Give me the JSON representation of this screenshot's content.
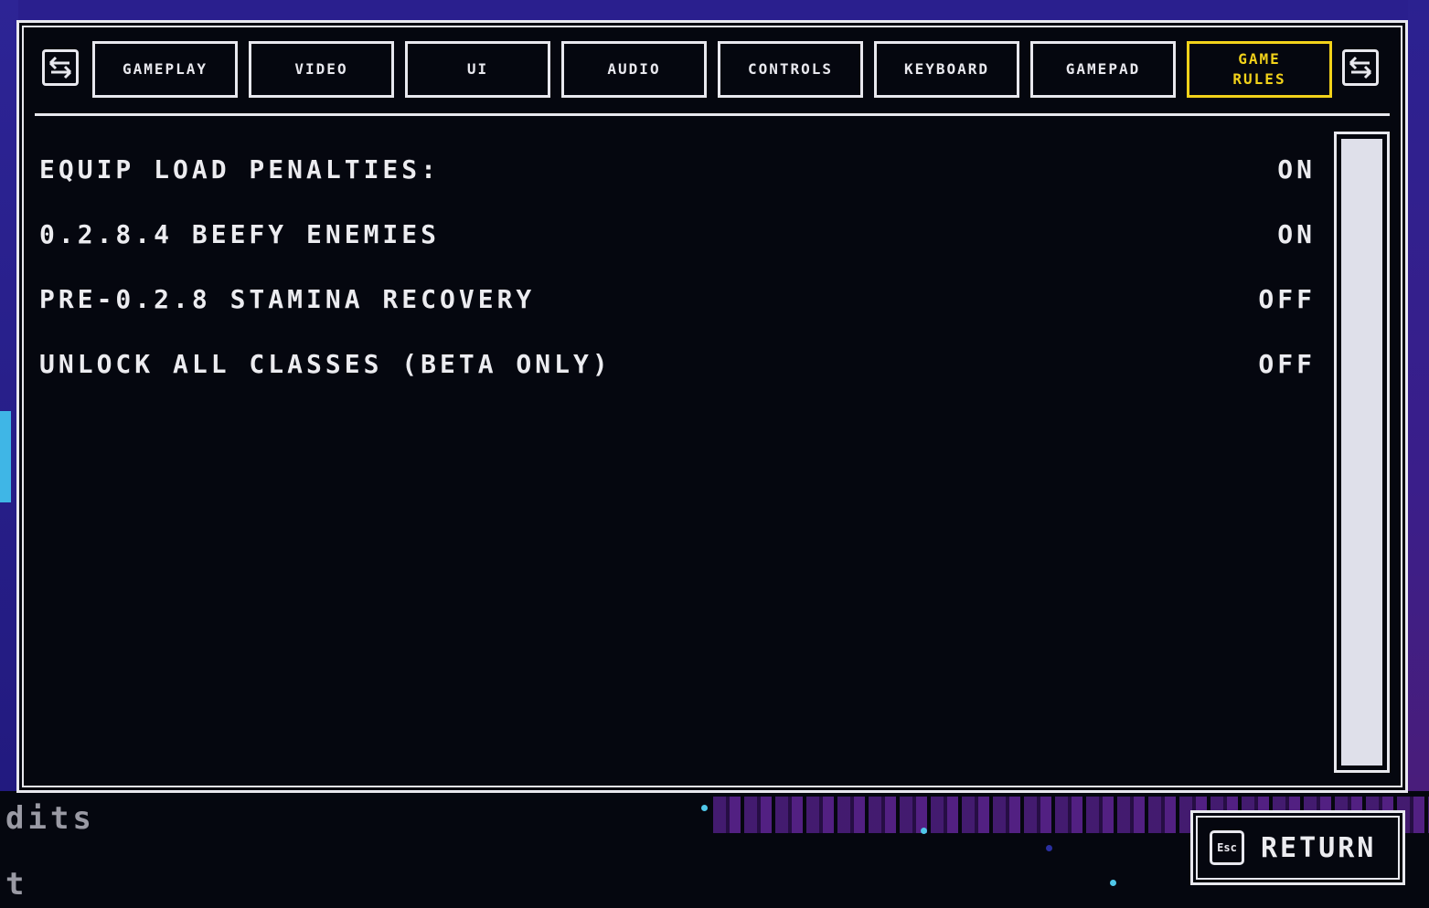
{
  "tabs": [
    {
      "label": "GAMEPLAY",
      "active": false
    },
    {
      "label": "VIDEO",
      "active": false
    },
    {
      "label": "UI",
      "active": false
    },
    {
      "label": "AUDIO",
      "active": false
    },
    {
      "label": "CONTROLS",
      "active": false
    },
    {
      "label": "KEYBOARD",
      "active": false
    },
    {
      "label": "GAMEPAD",
      "active": false
    },
    {
      "label": "GAME\nRULES",
      "active": true
    }
  ],
  "settings": [
    {
      "label": "EQUIP LOAD PENALTIES:",
      "value": "ON"
    },
    {
      "label": "0.2.8.4 BEEFY ENEMIES",
      "value": "ON"
    },
    {
      "label": "PRE-0.2.8 STAMINA RECOVERY",
      "value": "OFF"
    },
    {
      "label": "UNLOCK ALL CLASSES (BETA ONLY)",
      "value": "OFF"
    }
  ],
  "return_button": {
    "key": "Esc",
    "label": "RETURN"
  },
  "background_menu": {
    "credits_fragment": "dits",
    "quit_fragment": "t"
  },
  "colors": {
    "accent": "#f2d21a",
    "panel_bg": "#05070f",
    "border": "#e8e8ee"
  },
  "icons": {
    "prev_tab": "swap-arrows-icon",
    "next_tab": "swap-arrows-icon"
  }
}
